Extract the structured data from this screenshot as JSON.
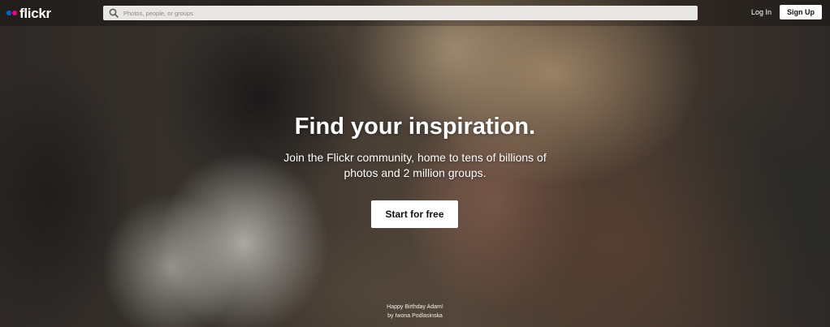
{
  "brand": {
    "logo_text": "flickr",
    "dot_colors": [
      "#0063dc",
      "#ff0084"
    ]
  },
  "header": {
    "search": {
      "placeholder": "Photos, people, or groups",
      "value": "",
      "icon": "search-icon"
    },
    "login_label": "Log In",
    "signup_label": "Sign Up"
  },
  "hero": {
    "title": "Find your inspiration.",
    "subtitle": "Join the Flickr community, home to tens of billions of photos and 2 million groups.",
    "cta_label": "Start for free"
  },
  "photo_credit": {
    "title": "Happy Birthday Adam!",
    "author": "by Iwona Podlasinska"
  }
}
